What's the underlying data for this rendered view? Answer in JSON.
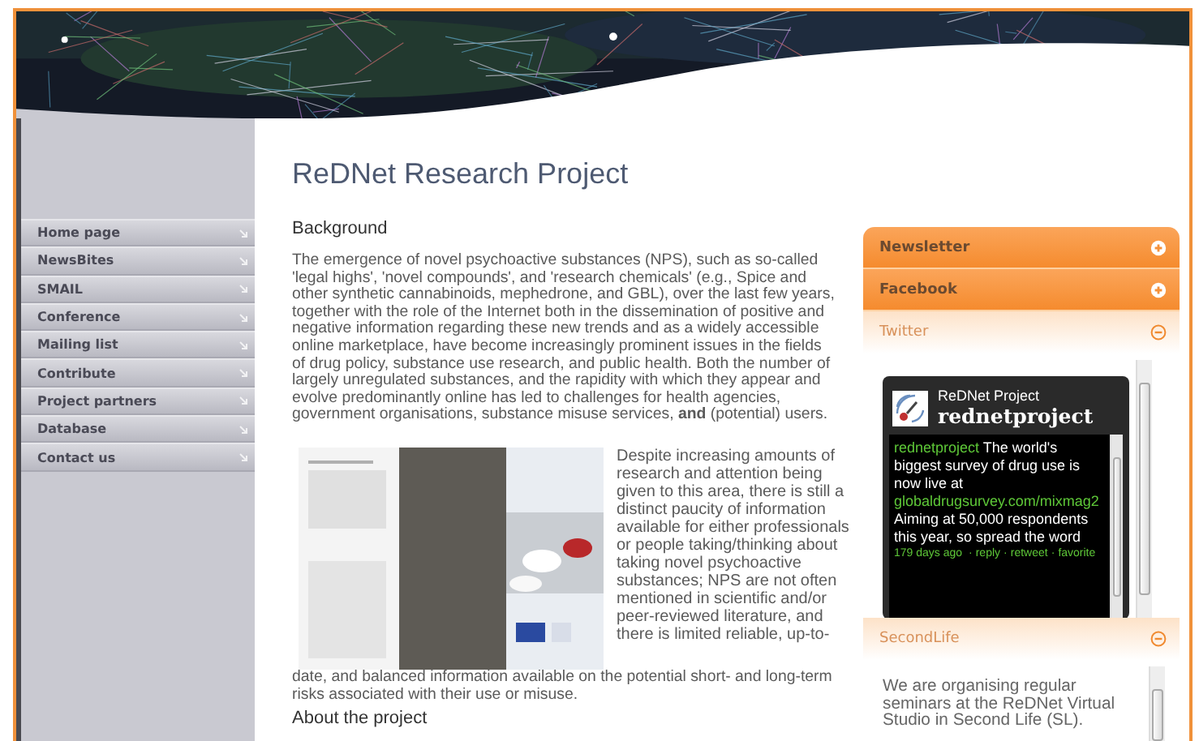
{
  "banner": {
    "kind": "picture"
  },
  "nav": [
    {
      "label": "Home page"
    },
    {
      "label": "NewsBites"
    },
    {
      "label": "SMAIL"
    },
    {
      "label": "Conference"
    },
    {
      "label": "Mailing list"
    },
    {
      "label": "Contribute"
    },
    {
      "label": "Project partners"
    },
    {
      "label": "Database"
    },
    {
      "label": "Contact us"
    }
  ],
  "page_title": "ReDNet Research Project",
  "section": {
    "heading": "Background",
    "paragraph_1": "The emergence of novel psychoactive substances (NPS), such as so-called 'legal highs', 'novel compounds', and 'research chemicals' (e.g., Spice and other synthetic cannabinoids, mephedrone, and GBL), over the last few years, together with the role of the Internet both in the dissemination of positive and negative information regarding these new trends and as a widely accessible online marketplace, have become increasingly prominent issues in the fields of drug policy, substance use research, and public health. Both the number of largely unregulated substances, and the rapidity with which they appear and evolve predominantly online has led to challenges for health agencies, government organisations, substance misuse services, **and** (potential) users.",
    "figure": {
      "kind": "picture"
    },
    "paragraph_2": [
      "Despite increasing amounts of research and attention being given to this area, there is still a distinct paucity of information available for either professionals or people taking/thinking about taking novel psychoactive substances; NPS are not often mentioned in scientific and/or peer-reviewed literature, and there is limited reliable, up-to-",
      "date, and balanced information available on the potential short- and long-term risks associated with their use or misuse."
    ]
  },
  "next_heading": "About the project",
  "side_panels": [
    {
      "title": "Newsletter",
      "expanded": false
    },
    {
      "title": "Facebook",
      "expanded": false
    },
    {
      "title": "Twitter",
      "expanded": true,
      "widget": {
        "name": "ReDNet Project",
        "handle": "rednetproject",
        "tweet": {
          "user": "rednetproject",
          "text_before": "The world's biggest survey of drug use is now live at",
          "link": "globaldrugsurvey.com/mixmag2",
          "text_after": "Aiming at 50,000 respondents this year, so spread the word",
          "time": "179 days ago",
          "separator": "·",
          "actions": [
            "reply",
            "retweet",
            "favorite"
          ]
        }
      }
    },
    {
      "title": "SecondLife",
      "expanded": true,
      "text": "We are organising regular seminars at the ReDNet Virtual Studio in Second Life (SL)."
    }
  ]
}
